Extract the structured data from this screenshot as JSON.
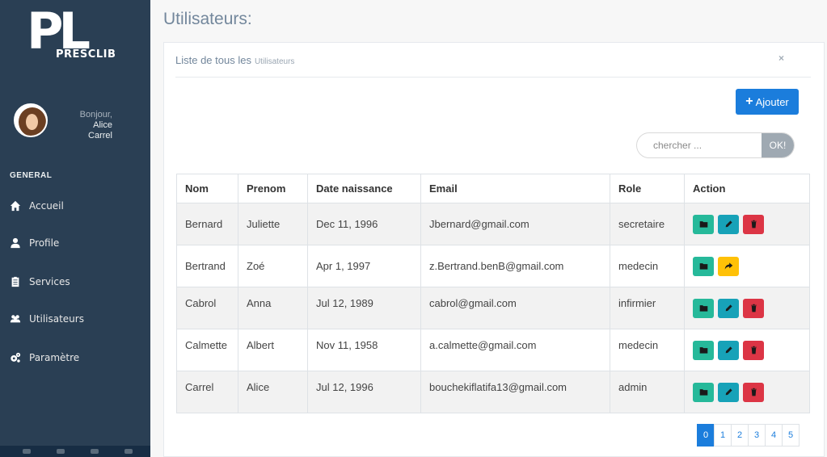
{
  "logo": {
    "mark": "PL",
    "text": "PRESCLIB"
  },
  "user": {
    "greeting": "Bonjour,",
    "first_name": "Alice",
    "last_name": "Carrel"
  },
  "sidebar": {
    "section": "GENERAL",
    "items": [
      {
        "label": "Accueil",
        "icon": "home-icon"
      },
      {
        "label": "Profile",
        "icon": "user-icon"
      },
      {
        "label": "Services",
        "icon": "clipboard-icon"
      },
      {
        "label": "Utilisateurs",
        "icon": "users-icon"
      },
      {
        "label": "Paramètre",
        "icon": "cogs-icon"
      }
    ]
  },
  "page": {
    "title": "Utilisateurs:"
  },
  "panel": {
    "heading": "Liste de tous les",
    "subheading": "Utilisateurs",
    "close": "×"
  },
  "toolbar": {
    "add_label": "Ajouter",
    "add_plus": "+"
  },
  "search": {
    "placeholder": "chercher ...",
    "button": "OK!"
  },
  "table": {
    "columns": [
      "Nom",
      "Prenom",
      "Date naissance",
      "Email",
      "Role",
      "Action"
    ],
    "rows": [
      {
        "nom": "Bernard",
        "prenom": "Juliette",
        "date": "Dec 11, 1996",
        "email": "Jbernard@gmail.com",
        "role": "secretaire",
        "actions": [
          "view",
          "edit",
          "delete"
        ]
      },
      {
        "nom": "Bertrand",
        "prenom": "Zoé",
        "date": "Apr 1, 1997",
        "email": "z.Bertrand.benB@gmail.com",
        "role": "medecin",
        "actions": [
          "view",
          "forward"
        ]
      },
      {
        "nom": "Cabrol",
        "prenom": "Anna",
        "date": "Jul 12, 1989",
        "email": "cabrol@gmail.com",
        "role": "infirmier",
        "actions": [
          "view",
          "edit",
          "delete"
        ]
      },
      {
        "nom": "Calmette",
        "prenom": "Albert",
        "date": "Nov 11, 1958",
        "email": "a.calmette@gmail.com",
        "role": "medecin",
        "actions": [
          "view",
          "edit",
          "delete"
        ]
      },
      {
        "nom": "Carrel",
        "prenom": "Alice",
        "date": "Jul 12, 1996",
        "email": "bouchekiflatifa13@gmail.com",
        "role": "admin",
        "actions": [
          "view",
          "edit",
          "delete"
        ]
      }
    ]
  },
  "pagination": {
    "pages": [
      "0",
      "1",
      "2",
      "3",
      "4",
      "5"
    ],
    "current": "0"
  },
  "colors": {
    "sidebar": "#2a3f54",
    "primary": "#1b7ddc",
    "success": "#26b99a",
    "info": "#17a2b8",
    "danger": "#dc3545",
    "warning": "#ffc107"
  }
}
